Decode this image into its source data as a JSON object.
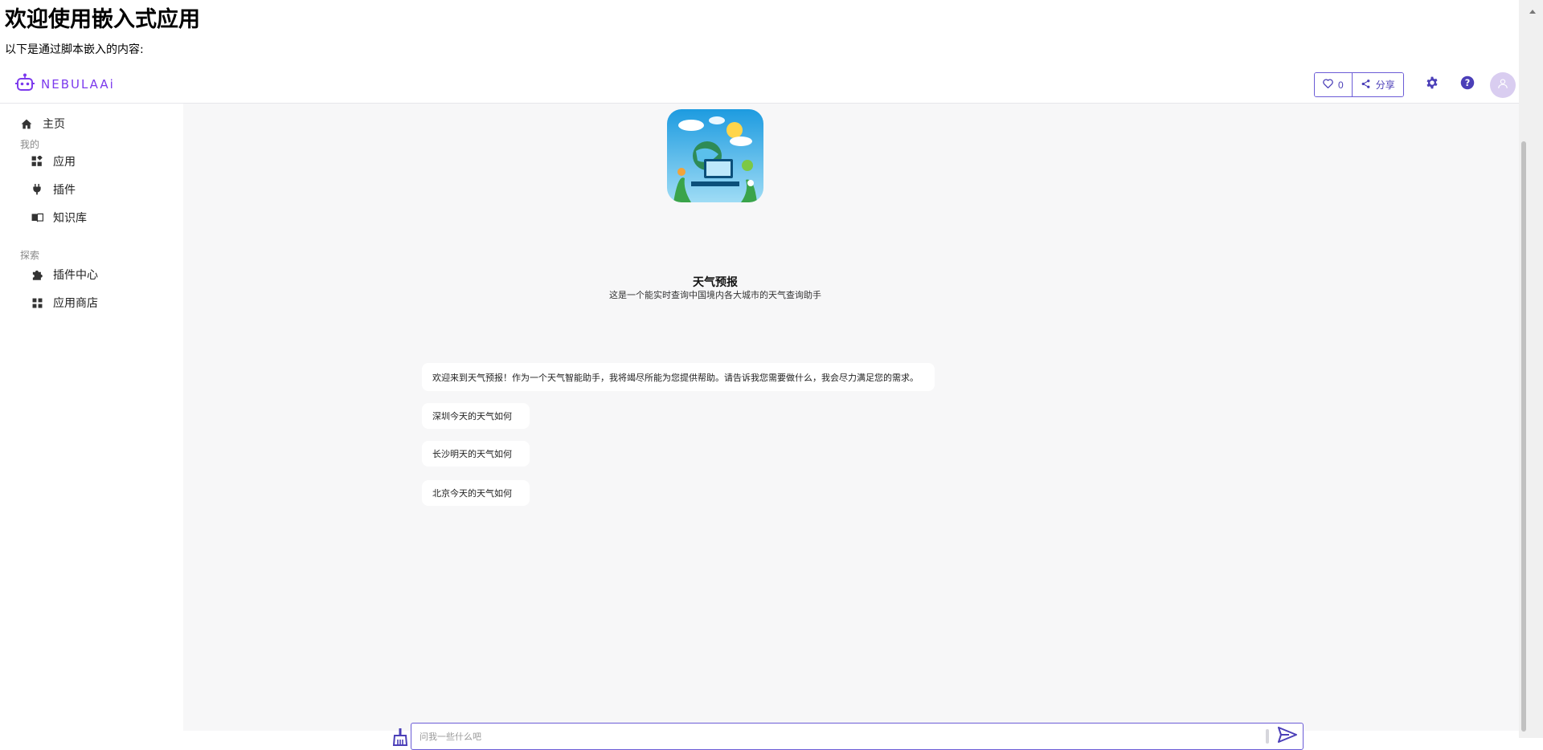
{
  "page": {
    "title": "欢迎使用嵌入式应用",
    "subtitle": "以下是通过脚本嵌入的内容:"
  },
  "topbar": {
    "logo_text": "NEBULAAi",
    "like_count": "0",
    "share_label": "分享"
  },
  "sidebar": {
    "home": "主页",
    "section_mine": "我的",
    "apps": "应用",
    "plugins": "插件",
    "knowledge": "知识库",
    "section_explore": "探索",
    "plugin_center": "插件中心",
    "app_store": "应用商店"
  },
  "app": {
    "name": "天气预报",
    "description": "这是一个能实时查询中国境内各大城市的天气查询助手"
  },
  "chat": {
    "welcome": "欢迎来到天气预报！作为一个天气智能助手，我将竭尽所能为您提供帮助。请告诉我您需要做什么，我会尽力满足您的需求。",
    "suggestions": [
      "深圳今天的天气如何",
      "长沙明天的天气如何",
      "北京今天的天气如何"
    ],
    "input_placeholder": "问我一些什么吧"
  },
  "colors": {
    "accent": "#6b5cd6",
    "brand": "#7c3aed",
    "panel_bg": "#f7f7f8"
  }
}
